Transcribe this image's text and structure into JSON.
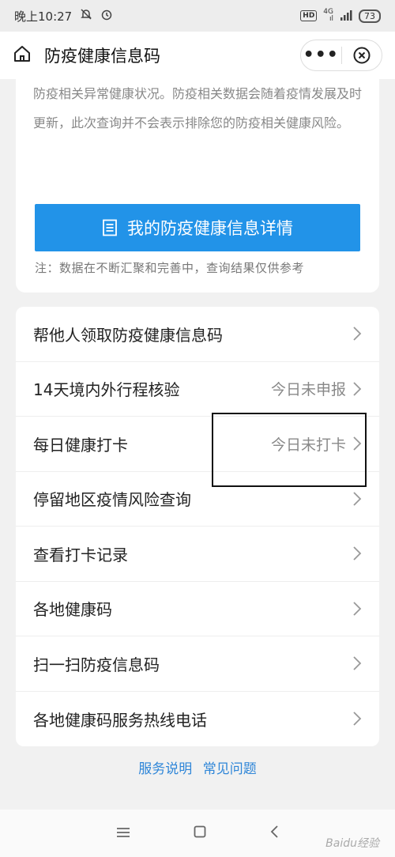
{
  "status_bar": {
    "time": "晚上10:27",
    "hd": "HD",
    "network_top": "4G",
    "network_bottom": "ıl",
    "battery": "73"
  },
  "header": {
    "title": "防疫健康信息码",
    "more_label": "•••"
  },
  "notice": {
    "text": "防疫相关异常健康状况。防疫相关数据会随着疫情发展及时更新，此次查询并不会表示排除您的防疫相关健康风险。"
  },
  "detail_button": {
    "label": "我的防疫健康信息详情"
  },
  "footnote": "注：数据在不断汇聚和完善中，查询结果仅供参考",
  "menu": {
    "items": [
      {
        "label": "帮他人领取防疫健康信息码",
        "status": ""
      },
      {
        "label": "14天境内外行程核验",
        "status": "今日未申报"
      },
      {
        "label": "每日健康打卡",
        "status": "今日未打卡"
      },
      {
        "label": "停留地区疫情风险查询",
        "status": ""
      },
      {
        "label": "查看打卡记录",
        "status": ""
      },
      {
        "label": "各地健康码",
        "status": ""
      },
      {
        "label": "扫一扫防疫信息码",
        "status": ""
      },
      {
        "label": "各地健康码服务热线电话",
        "status": ""
      }
    ]
  },
  "links": {
    "service": "服务说明",
    "faq": "常见问题"
  },
  "watermark": "Baidu经验",
  "colors": {
    "accent": "#2293e8",
    "link": "#2f86d8"
  }
}
